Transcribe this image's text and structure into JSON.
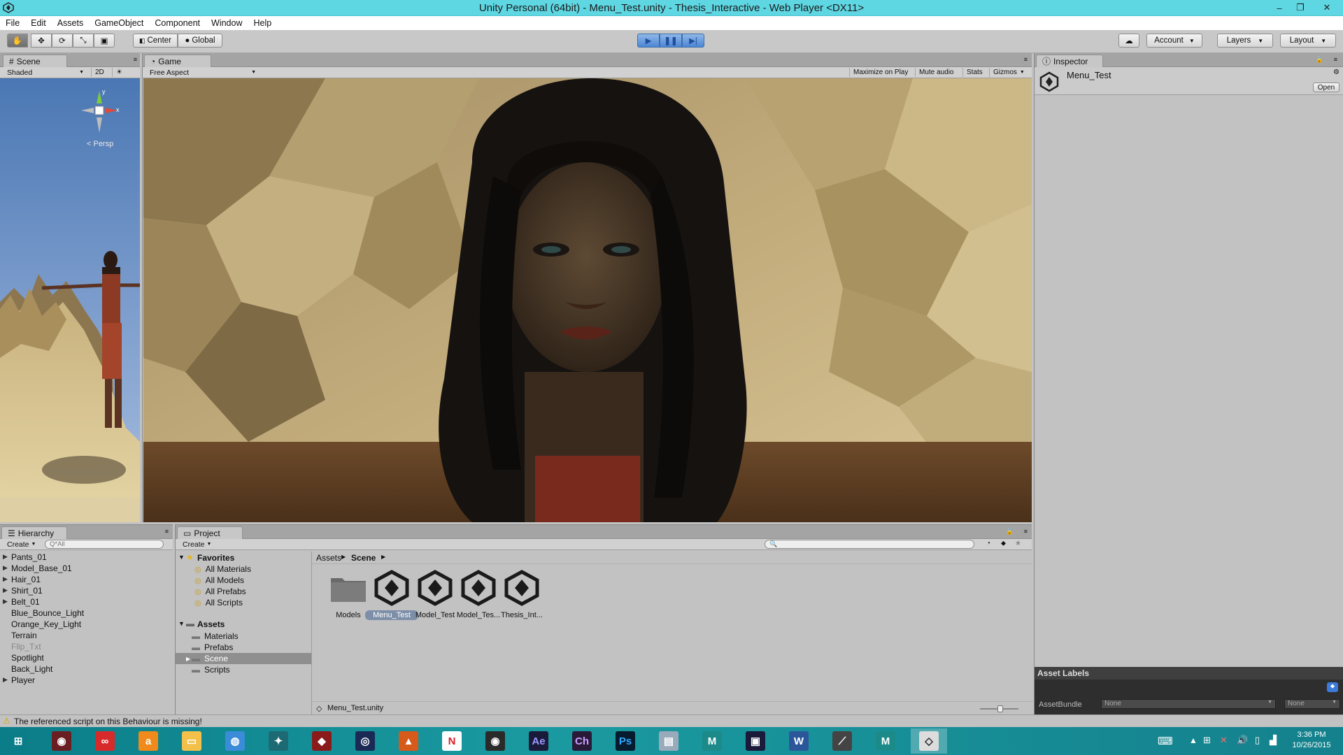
{
  "window": {
    "title": "Unity Personal (64bit) - Menu_Test.unity - Thesis_Interactive - Web Player <DX11>"
  },
  "menu": [
    "File",
    "Edit",
    "Assets",
    "GameObject",
    "Component",
    "Window",
    "Help"
  ],
  "toolbar": {
    "center": "Center",
    "global": "Global",
    "account": "Account",
    "layers": "Layers",
    "layout": "Layout"
  },
  "scene": {
    "tab": "Scene",
    "shading": "Shaded",
    "mode2d": "2D",
    "persp": "< Persp",
    "axis_x": "x",
    "axis_y": "y"
  },
  "game": {
    "tab": "Game",
    "aspect": "Free Aspect",
    "maximize": "Maximize on Play",
    "mute": "Mute audio",
    "stats": "Stats",
    "gizmos": "Gizmos"
  },
  "inspector": {
    "tab": "Inspector",
    "object": "Menu_Test",
    "open": "Open",
    "asset_labels": "Asset Labels",
    "asset_bundle": "AssetBundle",
    "none1": "None",
    "none2": "None"
  },
  "hierarchy": {
    "tab": "Hierarchy",
    "create": "Create",
    "search_placeholder": "Q*All",
    "items": [
      {
        "name": "Pants_01",
        "expandable": true
      },
      {
        "name": "Model_Base_01",
        "expandable": true
      },
      {
        "name": "Hair_01",
        "expandable": true
      },
      {
        "name": "Shirt_01",
        "expandable": true
      },
      {
        "name": "Belt_01",
        "expandable": true
      },
      {
        "name": "Blue_Bounce_Light",
        "expandable": false
      },
      {
        "name": "Orange_Key_Light",
        "expandable": false
      },
      {
        "name": "Terrain",
        "expandable": false
      },
      {
        "name": "Flip_Txt",
        "expandable": false,
        "disabled": true
      },
      {
        "name": "Spotlight",
        "expandable": false
      },
      {
        "name": "Back_Light",
        "expandable": false
      },
      {
        "name": "Player",
        "expandable": true
      }
    ]
  },
  "project": {
    "tab": "Project",
    "create": "Create",
    "favorites_label": "Favorites",
    "favorites": [
      "All Materials",
      "All Models",
      "All Prefabs",
      "All Scripts"
    ],
    "assets_label": "Assets",
    "folders": [
      "Materials",
      "Prefabs",
      "Scene",
      "Scripts"
    ],
    "breadcrumb": [
      "Assets",
      "Scene"
    ],
    "assets": [
      {
        "name": "Models",
        "type": "folder"
      },
      {
        "name": "Menu_Test",
        "type": "unity",
        "selected": true
      },
      {
        "name": "Model_Test",
        "type": "unity"
      },
      {
        "name": "Model_Tes...",
        "type": "unity"
      },
      {
        "name": "Thesis_Int...",
        "type": "unity"
      }
    ],
    "footer_file": "Menu_Test.unity"
  },
  "status": {
    "message": "The referenced script on this Behaviour is missing!"
  },
  "taskbar": {
    "apps": [
      "start-icon",
      "davinci-icon",
      "creative-cloud-icon",
      "amazon-icon",
      "file-explorer-icon",
      "chrome-icon",
      "zbrush-icon",
      "ruby-icon",
      "cinema4d-icon",
      "mudbox-icon",
      "netflix-icon",
      "substance-icon",
      "after-effects-icon",
      "character-animator-icon",
      "photoshop-icon",
      "paint-icon",
      "maya-icon",
      "vegas-icon",
      "word-icon",
      "tool-icon",
      "maya2-icon",
      "unity-icon"
    ],
    "ae": "Ae",
    "ch": "Ch",
    "ps": "Ps",
    "netflix": "N",
    "time": "3:36 PM",
    "date": "10/26/2015"
  }
}
